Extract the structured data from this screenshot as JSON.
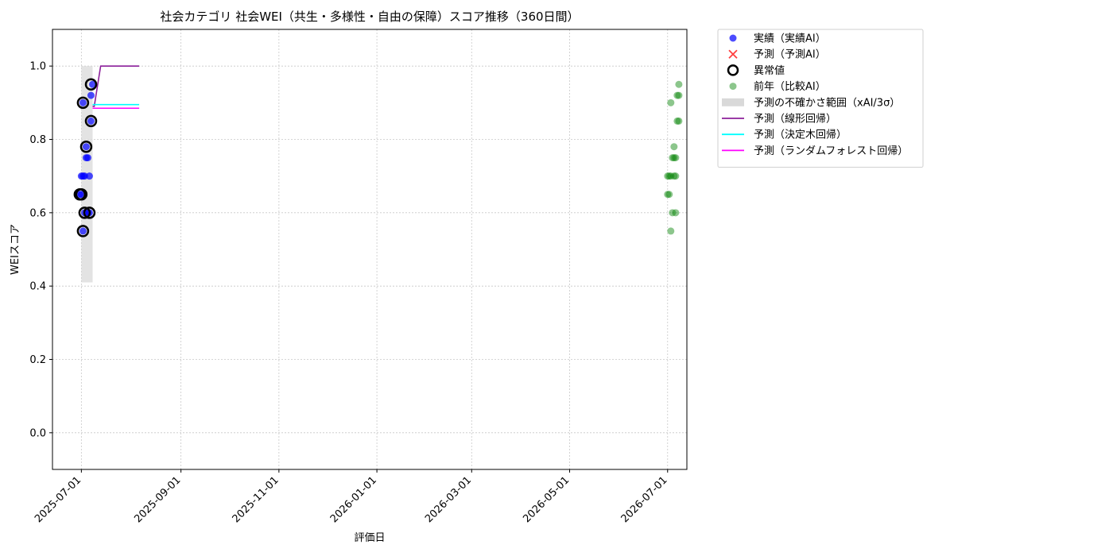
{
  "chart_data": {
    "type": "scatter",
    "title": "社会カテゴリ 社会WEI（共生・多様性・自由の保障）スコア推移（360日間）",
    "xlabel": "評価日",
    "ylabel": "WEIスコア",
    "x_range": [
      "2025-06-13",
      "2026-07-13"
    ],
    "ylim": [
      -0.1,
      1.1
    ],
    "x_ticks": [
      "2025-07-01",
      "2025-09-01",
      "2025-11-01",
      "2026-01-01",
      "2026-03-01",
      "2026-05-01",
      "2026-07-01"
    ],
    "y_ticks": [
      "0.0",
      "0.2",
      "0.4",
      "0.6",
      "0.8",
      "1.0"
    ],
    "grid": true,
    "legend_position": "outside-top-right",
    "legend": [
      {
        "label": "実績（実績AI）",
        "kind": "dot",
        "color": "#0000ff"
      },
      {
        "label": "予測（予測AI）",
        "kind": "x",
        "color": "#ff0000"
      },
      {
        "label": "異常値",
        "kind": "ring",
        "color": "#000000"
      },
      {
        "label": "前年（比較AI）",
        "kind": "dot",
        "color": "#008000"
      },
      {
        "label": "予測の不確かさ範囲（xAI/3σ）",
        "kind": "band",
        "color": "#d9d9d9"
      },
      {
        "label": "予測（線形回帰）",
        "kind": "line",
        "color": "#8b1f9a"
      },
      {
        "label": "予測（決定木回帰）",
        "kind": "line",
        "color": "#00ffff"
      },
      {
        "label": "予測（ランダムフォレスト回帰）",
        "kind": "line",
        "color": "#ff00ff"
      }
    ],
    "series": [
      {
        "name": "実績（実績AI）",
        "color": "#0000ff",
        "points": [
          {
            "x": "2025-06-30",
            "y": 0.65
          },
          {
            "x": "2025-07-01",
            "y": 0.65
          },
          {
            "x": "2025-07-01",
            "y": 0.7
          },
          {
            "x": "2025-07-02",
            "y": 0.55
          },
          {
            "x": "2025-07-02",
            "y": 0.9
          },
          {
            "x": "2025-07-02",
            "y": 0.7
          },
          {
            "x": "2025-07-03",
            "y": 0.6
          },
          {
            "x": "2025-07-03",
            "y": 0.7
          },
          {
            "x": "2025-07-04",
            "y": 0.78
          },
          {
            "x": "2025-07-04",
            "y": 0.75
          },
          {
            "x": "2025-07-05",
            "y": 0.75
          },
          {
            "x": "2025-07-05",
            "y": 0.6
          },
          {
            "x": "2025-07-06",
            "y": 0.7
          },
          {
            "x": "2025-07-06",
            "y": 0.6
          },
          {
            "x": "2025-07-07",
            "y": 0.92
          },
          {
            "x": "2025-07-07",
            "y": 0.85
          },
          {
            "x": "2025-07-08",
            "y": 0.95
          }
        ]
      },
      {
        "name": "異常値",
        "color": "#000000",
        "points": [
          {
            "x": "2025-06-30",
            "y": 0.65
          },
          {
            "x": "2025-07-01",
            "y": 0.65
          },
          {
            "x": "2025-07-02",
            "y": 0.55
          },
          {
            "x": "2025-07-02",
            "y": 0.9
          },
          {
            "x": "2025-07-03",
            "y": 0.6
          },
          {
            "x": "2025-07-04",
            "y": 0.78
          },
          {
            "x": "2025-07-06",
            "y": 0.6
          },
          {
            "x": "2025-07-07",
            "y": 0.85
          },
          {
            "x": "2025-07-07",
            "y": 0.95
          }
        ]
      },
      {
        "name": "前年（比較AI）",
        "color": "#008000",
        "points": [
          {
            "x": "2026-07-01",
            "y": 0.7
          },
          {
            "x": "2026-07-01",
            "y": 0.65
          },
          {
            "x": "2026-07-02",
            "y": 0.7
          },
          {
            "x": "2026-07-02",
            "y": 0.65
          },
          {
            "x": "2026-07-03",
            "y": 0.55
          },
          {
            "x": "2026-07-03",
            "y": 0.9
          },
          {
            "x": "2026-07-03",
            "y": 0.7
          },
          {
            "x": "2026-07-04",
            "y": 0.6
          },
          {
            "x": "2026-07-04",
            "y": 0.75
          },
          {
            "x": "2026-07-05",
            "y": 0.78
          },
          {
            "x": "2026-07-05",
            "y": 0.7
          },
          {
            "x": "2026-07-05",
            "y": 0.75
          },
          {
            "x": "2026-07-06",
            "y": 0.6
          },
          {
            "x": "2026-07-06",
            "y": 0.75
          },
          {
            "x": "2026-07-06",
            "y": 0.7
          },
          {
            "x": "2026-07-07",
            "y": 0.92
          },
          {
            "x": "2026-07-07",
            "y": 0.85
          },
          {
            "x": "2026-07-08",
            "y": 0.95
          },
          {
            "x": "2026-07-08",
            "y": 0.92
          },
          {
            "x": "2026-07-08",
            "y": 0.85
          }
        ]
      },
      {
        "name": "予測の不確かさ範囲（xAI/3σ）",
        "color": "#d9d9d9",
        "x_start": "2025-07-01",
        "x_end": "2025-07-08",
        "y_low": 0.41,
        "y_high": 1.0
      },
      {
        "name": "予測（線形回帰）",
        "color": "#8b1f9a",
        "points": [
          {
            "x": "2025-07-08",
            "y": 0.89
          },
          {
            "x": "2025-07-09",
            "y": 0.89
          },
          {
            "x": "2025-07-13",
            "y": 1.0
          },
          {
            "x": "2025-08-06",
            "y": 1.0
          }
        ]
      },
      {
        "name": "予測（決定木回帰）",
        "color": "#00ffff",
        "points": [
          {
            "x": "2025-07-08",
            "y": 0.895
          },
          {
            "x": "2025-08-06",
            "y": 0.895
          }
        ]
      },
      {
        "name": "予測（ランダムフォレスト回帰）",
        "color": "#ff00ff",
        "points": [
          {
            "x": "2025-07-08",
            "y": 0.885
          },
          {
            "x": "2025-08-06",
            "y": 0.885
          }
        ]
      }
    ]
  }
}
